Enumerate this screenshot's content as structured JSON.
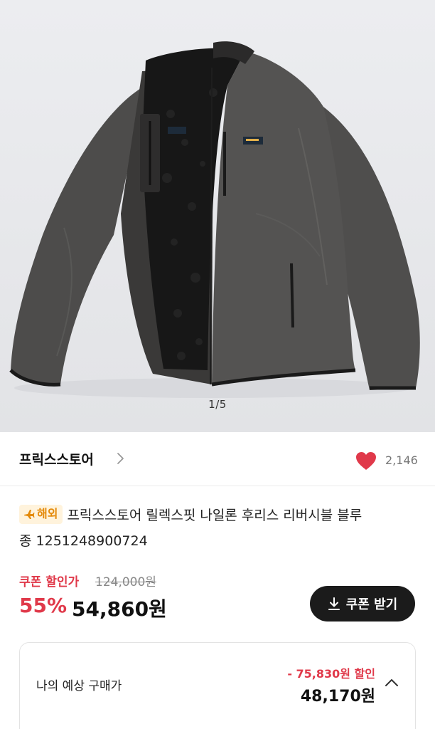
{
  "hero": {
    "page_indicator": "1/5",
    "image_subject": "reversible nylon fleece jacket, charcoal gray"
  },
  "store": {
    "name": "프릭스스토어",
    "like_count": "2,146",
    "heart_color": "#e0394a"
  },
  "product": {
    "badge_label": "해외",
    "badge_icon": "airplane-icon",
    "title_line1": "프릭스스토어 릴렉스핏 나일론 후리스 리버시블 블루",
    "title_line2": "종 1251248900724"
  },
  "price": {
    "coupon_label": "쿠폰 할인가",
    "original_price": "124,000원",
    "discount_percent": "55%",
    "sale_price": "54,860원",
    "accent_color": "#e0394a"
  },
  "coupon_button": {
    "label": "쿠폰 받기",
    "icon": "download-icon"
  },
  "estimate": {
    "label": "나의 예상 구매가",
    "discount_text": "- 75,830원 할인",
    "final_price": "48,170원",
    "toggle_icon": "chevron-up-icon"
  }
}
